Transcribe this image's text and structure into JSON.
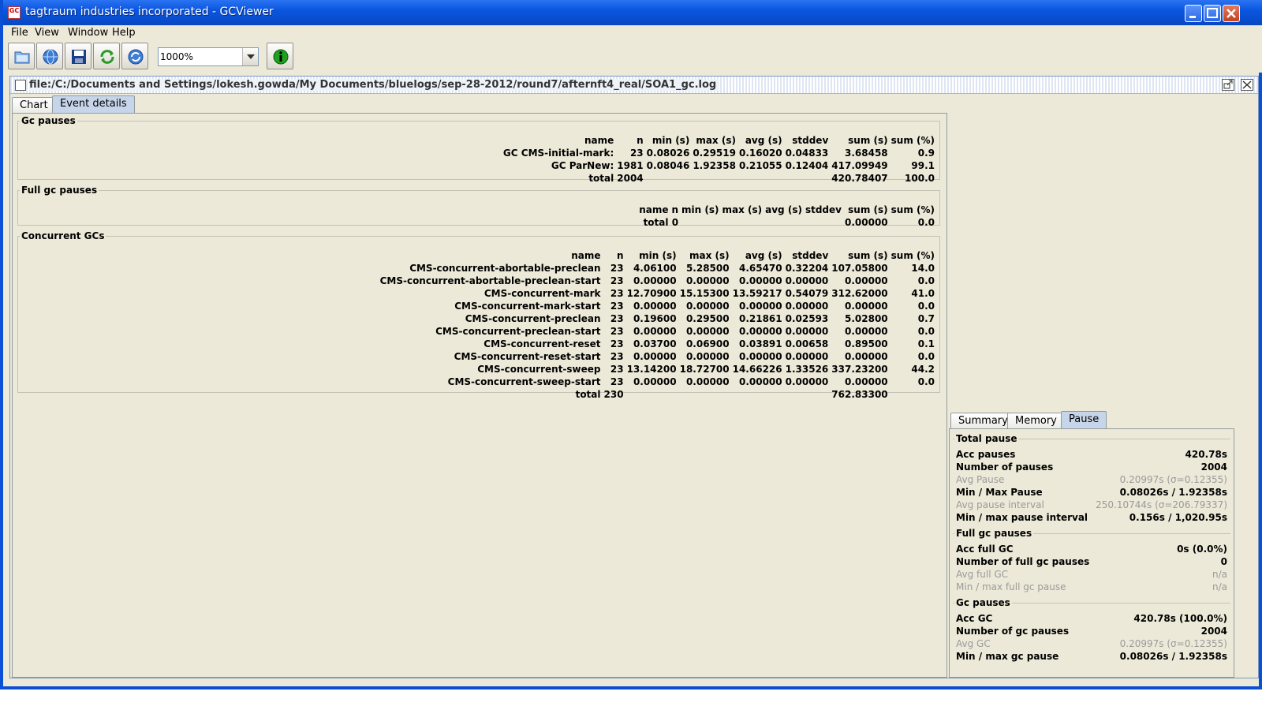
{
  "window": {
    "title": "tagtraum industries incorporated - GCViewer",
    "icon_text": "GC"
  },
  "menu": {
    "file": "File",
    "view": "View",
    "window": "Window",
    "help": "Help"
  },
  "toolbar": {
    "zoom_value": "1000%"
  },
  "frame": {
    "path": "file:/C:/Documents and Settings/lokesh.gowda/My Documents/bluelogs/sep-28-2012/round7/afternft4_real/SOA1_gc.log"
  },
  "tabs": {
    "chart": "Chart",
    "event_details": "Event details"
  },
  "gc_pauses": {
    "title": "Gc pauses",
    "headers": [
      "name",
      "n",
      "min (s)",
      "max (s)",
      "avg (s)",
      "stddev",
      "sum (s)",
      "sum (%)"
    ],
    "rows": [
      [
        "GC CMS-initial-mark:",
        "23",
        "0.08026",
        "0.29519",
        "0.16020",
        "0.04833",
        "3.68458",
        "0.9"
      ],
      [
        "GC ParNew:",
        "1981",
        "0.08046",
        "1.92358",
        "0.21055",
        "0.12404",
        "417.09949",
        "99.1"
      ],
      [
        "total",
        "2004",
        "",
        "",
        "",
        "",
        "420.78407",
        "100.0"
      ]
    ]
  },
  "full_gc_pauses": {
    "title": "Full gc pauses",
    "headers": [
      "name",
      "n",
      "min (s)",
      "max (s)",
      "avg (s)",
      "stddev",
      "sum (s)",
      "sum (%)"
    ],
    "rows": [
      [
        "total",
        "0",
        "",
        "",
        "",
        "",
        "0.00000",
        "0.0"
      ]
    ]
  },
  "concurrent_gcs": {
    "title": "Concurrent GCs",
    "headers": [
      "name",
      "n",
      "min (s)",
      "max (s)",
      "avg (s)",
      "stddev",
      "sum (s)",
      "sum (%)"
    ],
    "rows": [
      [
        "CMS-concurrent-abortable-preclean",
        "23",
        "4.06100",
        "5.28500",
        "4.65470",
        "0.32204",
        "107.05800",
        "14.0"
      ],
      [
        "CMS-concurrent-abortable-preclean-start",
        "23",
        "0.00000",
        "0.00000",
        "0.00000",
        "0.00000",
        "0.00000",
        "0.0"
      ],
      [
        "CMS-concurrent-mark",
        "23",
        "12.70900",
        "15.15300",
        "13.59217",
        "0.54079",
        "312.62000",
        "41.0"
      ],
      [
        "CMS-concurrent-mark-start",
        "23",
        "0.00000",
        "0.00000",
        "0.00000",
        "0.00000",
        "0.00000",
        "0.0"
      ],
      [
        "CMS-concurrent-preclean",
        "23",
        "0.19600",
        "0.29500",
        "0.21861",
        "0.02593",
        "5.02800",
        "0.7"
      ],
      [
        "CMS-concurrent-preclean-start",
        "23",
        "0.00000",
        "0.00000",
        "0.00000",
        "0.00000",
        "0.00000",
        "0.0"
      ],
      [
        "CMS-concurrent-reset",
        "23",
        "0.03700",
        "0.06900",
        "0.03891",
        "0.00658",
        "0.89500",
        "0.1"
      ],
      [
        "CMS-concurrent-reset-start",
        "23",
        "0.00000",
        "0.00000",
        "0.00000",
        "0.00000",
        "0.00000",
        "0.0"
      ],
      [
        "CMS-concurrent-sweep",
        "23",
        "13.14200",
        "18.72700",
        "14.66226",
        "1.33526",
        "337.23200",
        "44.2"
      ],
      [
        "CMS-concurrent-sweep-start",
        "23",
        "0.00000",
        "0.00000",
        "0.00000",
        "0.00000",
        "0.00000",
        "0.0"
      ],
      [
        "total",
        "230",
        "",
        "",
        "",
        "",
        "762.83300",
        ""
      ]
    ]
  },
  "right_tabs": {
    "summary": "Summary",
    "memory": "Memory",
    "pause": "Pause"
  },
  "pause_panel": {
    "total_pause": {
      "title": "Total pause",
      "rows": [
        {
          "label": "Acc pauses",
          "value": "420.78s",
          "dim": false
        },
        {
          "label": "Number of pauses",
          "value": "2004",
          "dim": false
        },
        {
          "label": "Avg Pause",
          "value": "0.20997s (σ=0.12355)",
          "dim": true
        },
        {
          "label": "Min / Max Pause",
          "value": "0.08026s / 1.92358s",
          "dim": false
        },
        {
          "label": "Avg pause interval",
          "value": "250.10744s (σ=206.79337)",
          "dim": true
        },
        {
          "label": "Min / max pause interval",
          "value": "0.156s / 1,020.95s",
          "dim": false
        }
      ]
    },
    "full_gc_pauses": {
      "title": "Full gc pauses",
      "rows": [
        {
          "label": "Acc full GC",
          "value": "0s (0.0%)",
          "dim": false
        },
        {
          "label": "Number of full gc pauses",
          "value": "0",
          "dim": false
        },
        {
          "label": "Avg full GC",
          "value": "n/a",
          "dim": true
        },
        {
          "label": "Min / max full gc pause",
          "value": "n/a",
          "dim": true
        }
      ]
    },
    "gc_pauses": {
      "title": "Gc pauses",
      "rows": [
        {
          "label": "Acc GC",
          "value": "420.78s (100.0%)",
          "dim": false
        },
        {
          "label": "Number of gc pauses",
          "value": "2004",
          "dim": false
        },
        {
          "label": "Avg GC",
          "value": "0.20997s (σ=0.12355)",
          "dim": true
        },
        {
          "label": "Min / max gc pause",
          "value": "0.08026s / 1.92358s",
          "dim": false
        }
      ]
    }
  }
}
